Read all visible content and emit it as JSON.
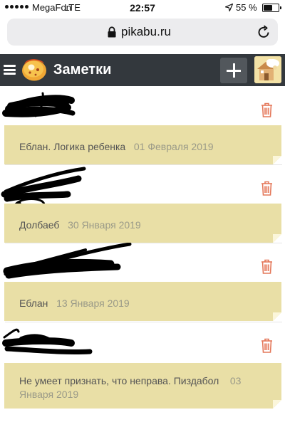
{
  "status_bar": {
    "carrier": "MegaFon",
    "network": "LTE",
    "time": "22:57",
    "battery": "55 %",
    "battery_level": 0.55
  },
  "browser": {
    "url": "pikabu.ru"
  },
  "header": {
    "title": "Заметки"
  },
  "notes": [
    {
      "text": "Еблан. Логика ребенка",
      "date": "01 Февраля 2019"
    },
    {
      "text": "Долбаеб",
      "date": "30 Января 2019"
    },
    {
      "text": "Еблан",
      "date": "13 Января 2019"
    },
    {
      "text": "Не умеет признать, что неправа. Пиздабол",
      "date": "03 Января 2019"
    }
  ],
  "colors": {
    "header_bg": "#33383d",
    "note_bg": "#e9dfa6",
    "trash_icon": "#e4785a"
  }
}
